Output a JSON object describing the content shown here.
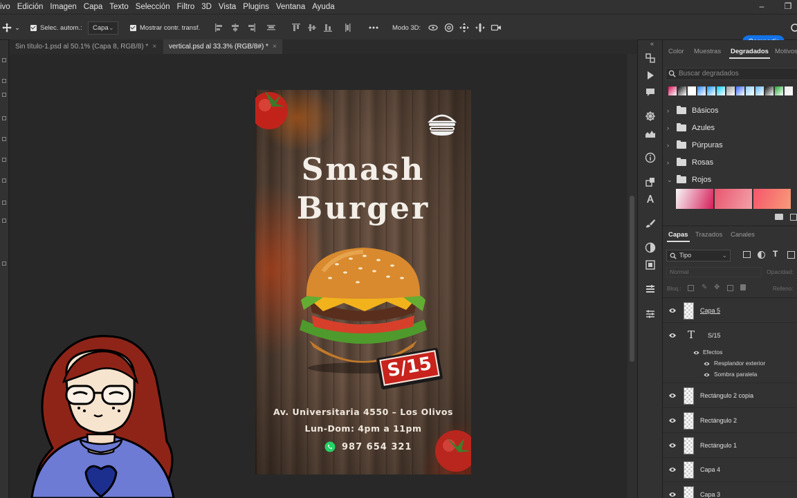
{
  "menu": [
    "ivo",
    "Edición",
    "Imagen",
    "Capa",
    "Texto",
    "Selección",
    "Filtro",
    "3D",
    "Vista",
    "Plugins",
    "Ventana",
    "Ayuda"
  ],
  "options_bar": {
    "auto_select_label": "Selec. autom.:",
    "auto_select_value": "Capa",
    "show_transform_label": "Mostrar contr. transf.",
    "mode3d_label": "Modo 3D:",
    "share_label": "Compartir"
  },
  "doc_tabs": [
    {
      "label": "Sin título-1.psd al 50.1% (Capa 8, RGB/8) *",
      "close": "×"
    },
    {
      "label": "vertical.psd al 33.3% (RGB/8#) *",
      "close": "×"
    }
  ],
  "poster": {
    "title_line1": "Smash",
    "title_line2": "Burger",
    "price": "S/15",
    "address": "Av. Universitaria 4550 – Los Olivos",
    "hours": "Lun-Dom: 4pm a 11pm",
    "phone": "987 654 321"
  },
  "gradients_panel": {
    "tabs": [
      "Color",
      "Muestras",
      "Degradados",
      "Motivos"
    ],
    "active_tab": "Degradados",
    "search_placeholder": "Buscar degradados",
    "folders": [
      "Básicos",
      "Azules",
      "Púrpuras",
      "Rosas",
      "Rojos"
    ],
    "swatch_colors": [
      "#d4145a",
      "#1a1a1a",
      "#ffffff",
      "#2e8bff",
      "#1a9bff",
      "#0ad0ff",
      "#9a9a9a",
      "#3b6cff",
      "#8ad0ff",
      "#66b6ff",
      "#1a1a1a",
      "#22aa33",
      "#e8e8e8"
    ],
    "red_gradients": [
      [
        "#f7f7f7",
        "#d61e5a"
      ],
      [
        "#e8566f",
        "#f3a0a8"
      ],
      [
        "#f5566c",
        "#f89b78"
      ]
    ]
  },
  "layers_panel": {
    "tabs": [
      "Capas",
      "Trazados",
      "Canales"
    ],
    "active_tab": "Capas",
    "filter_value": "Tipo",
    "blend_mode": "Normal",
    "opacity_label": "Opacidad:",
    "lock_label": "Bloq.:",
    "fill_label": "Relleno:",
    "layers": [
      {
        "name": "Capa 5",
        "type": "pixel"
      },
      {
        "name": "S/15",
        "type": "text"
      },
      {
        "name": "Rectángulo 2 copia",
        "type": "shape"
      },
      {
        "name": "Rectángulo 2",
        "type": "shape"
      },
      {
        "name": "Rectángulo 1",
        "type": "shape"
      },
      {
        "name": "Capa 4",
        "type": "pixel"
      },
      {
        "name": "Capa 3",
        "type": "pixel"
      }
    ],
    "effects_label": "Efectos",
    "effects": [
      "Resplandor exterior",
      "Sombra paralela"
    ]
  }
}
